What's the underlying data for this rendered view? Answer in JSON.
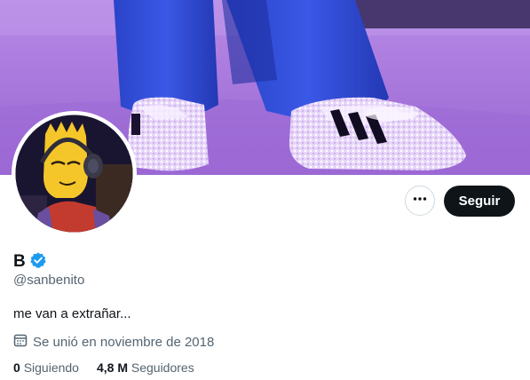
{
  "profile": {
    "display_name": "B",
    "handle": "@sanbenito",
    "bio": "me van a extrañar...",
    "joined": "Se unió en noviembre de 2018",
    "verified_color": "#1d9bf0"
  },
  "actions": {
    "more_icon": "ellipsis-icon",
    "follow_label": "Seguir"
  },
  "stats": {
    "following_count": "0",
    "following_label": "Siguiendo",
    "followers_count": "4,8 M",
    "followers_label": "Seguidores"
  },
  "colors": {
    "banner_tint": "#a070d8",
    "follow_bg": "#0f1419",
    "secondary_text": "#536471"
  }
}
